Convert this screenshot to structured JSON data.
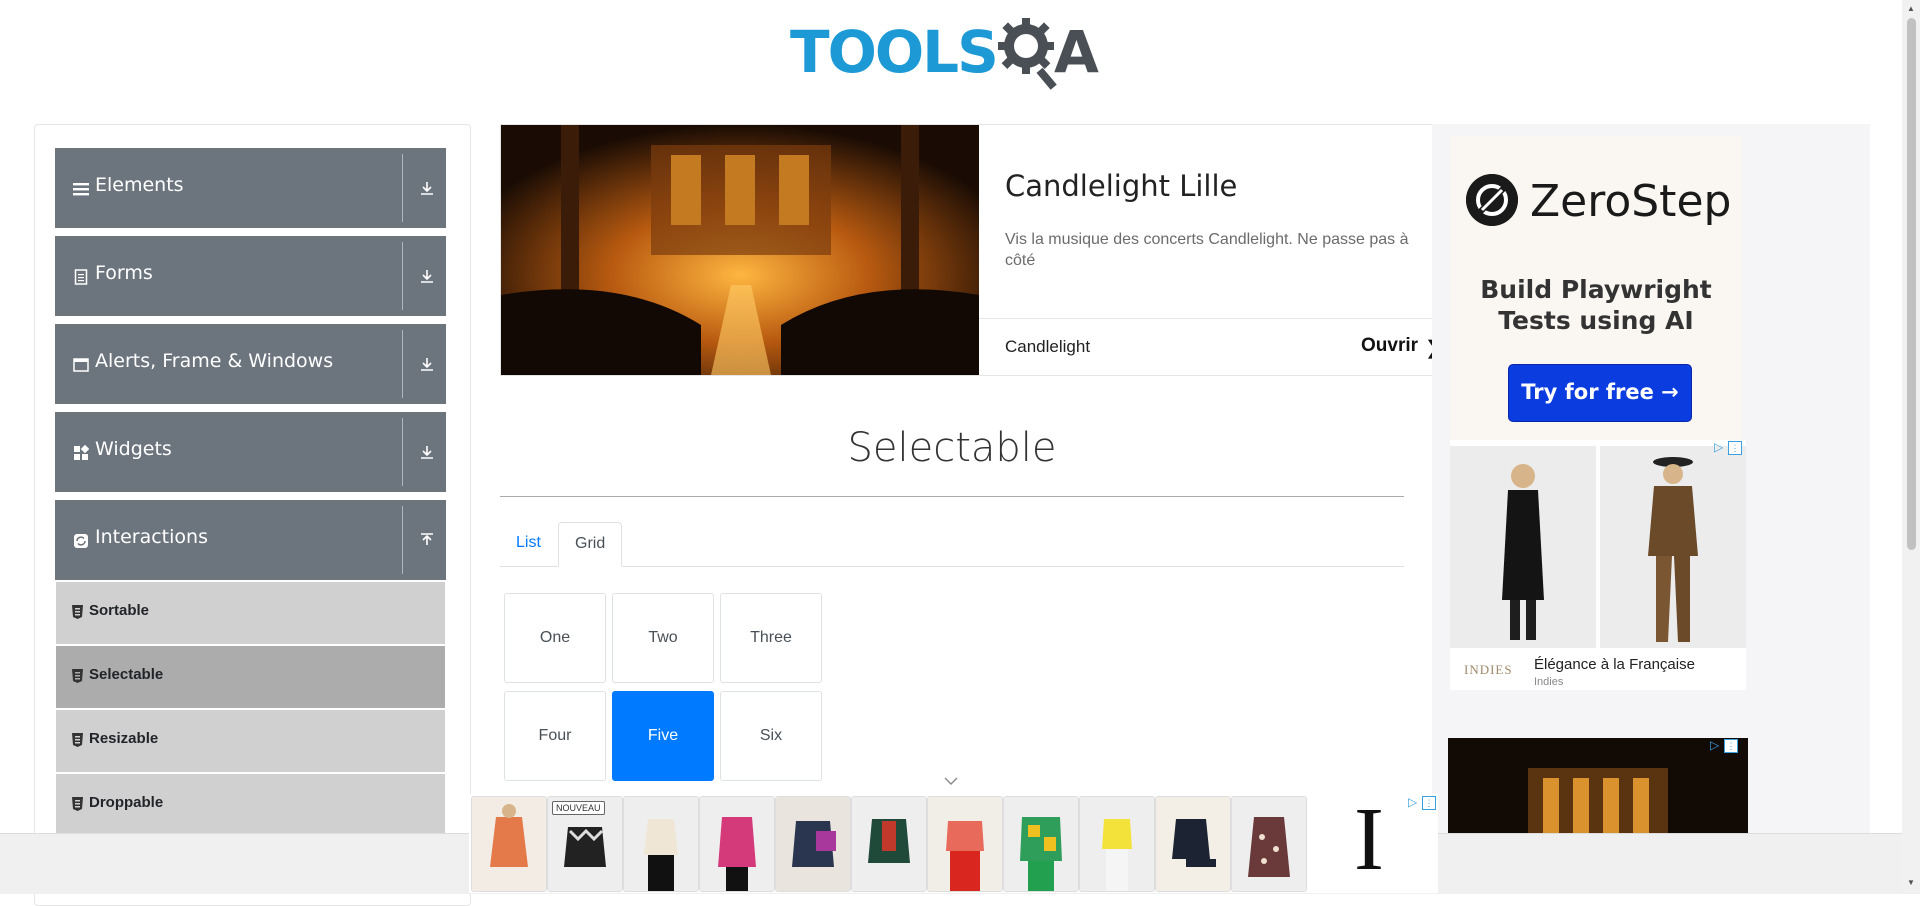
{
  "header": {
    "logo_main": "TOOLS",
    "logo_end": "A"
  },
  "sidebar": {
    "groups": [
      {
        "label": "Elements",
        "icon": "hamburger-icon",
        "state": "collapsed"
      },
      {
        "label": "Forms",
        "icon": "document-icon",
        "state": "collapsed"
      },
      {
        "label": "Alerts, Frame & Windows",
        "icon": "window-icon",
        "state": "collapsed"
      },
      {
        "label": "Widgets",
        "icon": "widgets-icon",
        "state": "collapsed"
      },
      {
        "label": "Interactions",
        "icon": "refresh-icon",
        "state": "expanded"
      }
    ],
    "items": [
      {
        "label": "Sortable",
        "active": false
      },
      {
        "label": "Selectable",
        "active": true
      },
      {
        "label": "Resizable",
        "active": false
      },
      {
        "label": "Droppable",
        "active": false
      }
    ]
  },
  "banner": {
    "title": "Candlelight Lille",
    "description": "Vis la musique des concerts Candlelight. Ne passe pas à côté",
    "brand": "Candlelight",
    "cta": "Ouvrir"
  },
  "main": {
    "title": "Selectable",
    "tabs": [
      {
        "label": "List",
        "active": false
      },
      {
        "label": "Grid",
        "active": true
      }
    ],
    "grid": [
      [
        "One",
        "Two",
        "Three"
      ],
      [
        "Four",
        "Five",
        "Six"
      ]
    ],
    "selected": "Five"
  },
  "right_ad": {
    "brand": "ZeroStep",
    "tagline_line1": "Build Playwright",
    "tagline_line2": "Tests using AI",
    "cta": "Try for free →",
    "fashion_title": "Élégance à la Française",
    "fashion_sub": "Indies",
    "fashion_brand": "INDIES"
  },
  "bottom_ad": {
    "badge": "NOUVEAU",
    "logo": "I"
  },
  "colors": {
    "accent": "#007bff",
    "sidebar_header": "#6c757d",
    "logo_blue": "#1d9ad6"
  }
}
